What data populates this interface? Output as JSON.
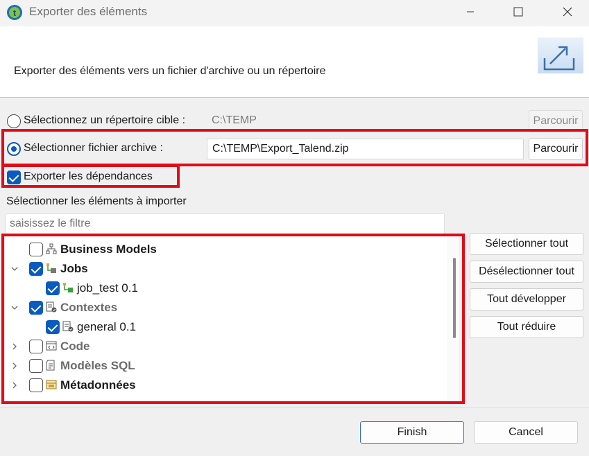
{
  "window": {
    "title": "Exporter des éléments",
    "icon": "talend-logo-icon"
  },
  "banner": {
    "description": "Exporter des éléments vers un fichier d'archive ou un répertoire",
    "icon": "export-icon"
  },
  "target_directory": {
    "label": "Sélectionnez un répertoire cible :",
    "value": "C:\\TEMP",
    "browse_label": "Parcourir",
    "selected": false
  },
  "archive_file": {
    "label": "Sélectionner fichier archive :",
    "value": "C:\\TEMP\\Export_Talend.zip",
    "browse_label": "Parcourir",
    "selected": true
  },
  "export_dependencies": {
    "label": "Exporter les dépendances",
    "checked": true
  },
  "items_section": {
    "label": "Sélectionner les éléments à importer",
    "filter_placeholder": "saisissez le filtre"
  },
  "tree": [
    {
      "label": "Business Models",
      "checked": false,
      "expander": "",
      "level": 0,
      "style": "bold",
      "icon": "business-model-icon"
    },
    {
      "label": "Jobs",
      "checked": true,
      "expander": "expanded",
      "level": 0,
      "style": "bold",
      "icon": "jobs-icon"
    },
    {
      "label": "job_test 0.1",
      "checked": true,
      "expander": "",
      "level": 1,
      "style": "normal",
      "icon": "job-icon"
    },
    {
      "label": "Contextes",
      "checked": true,
      "expander": "expanded",
      "level": 0,
      "style": "bold-grey",
      "icon": "context-icon"
    },
    {
      "label": "general 0.1",
      "checked": true,
      "expander": "",
      "level": 1,
      "style": "normal",
      "icon": "context-item-icon"
    },
    {
      "label": "Code",
      "checked": false,
      "expander": "collapsed",
      "level": 0,
      "style": "bold-grey",
      "icon": "code-icon"
    },
    {
      "label": "Modèles SQL",
      "checked": false,
      "expander": "collapsed",
      "level": 0,
      "style": "bold-grey",
      "icon": "sql-template-icon"
    },
    {
      "label": "Métadonnées",
      "checked": false,
      "expander": "collapsed",
      "level": 0,
      "style": "bold",
      "icon": "metadata-icon"
    }
  ],
  "side_buttons": {
    "select_all": "Sélectionner tout",
    "deselect_all": "Désélectionner tout",
    "expand_all": "Tout développer",
    "collapse_all": "Tout réduire"
  },
  "footer": {
    "finish": "Finish",
    "cancel": "Cancel"
  },
  "colors": {
    "highlight": "#e30b17",
    "accent": "#0a5bbf"
  }
}
